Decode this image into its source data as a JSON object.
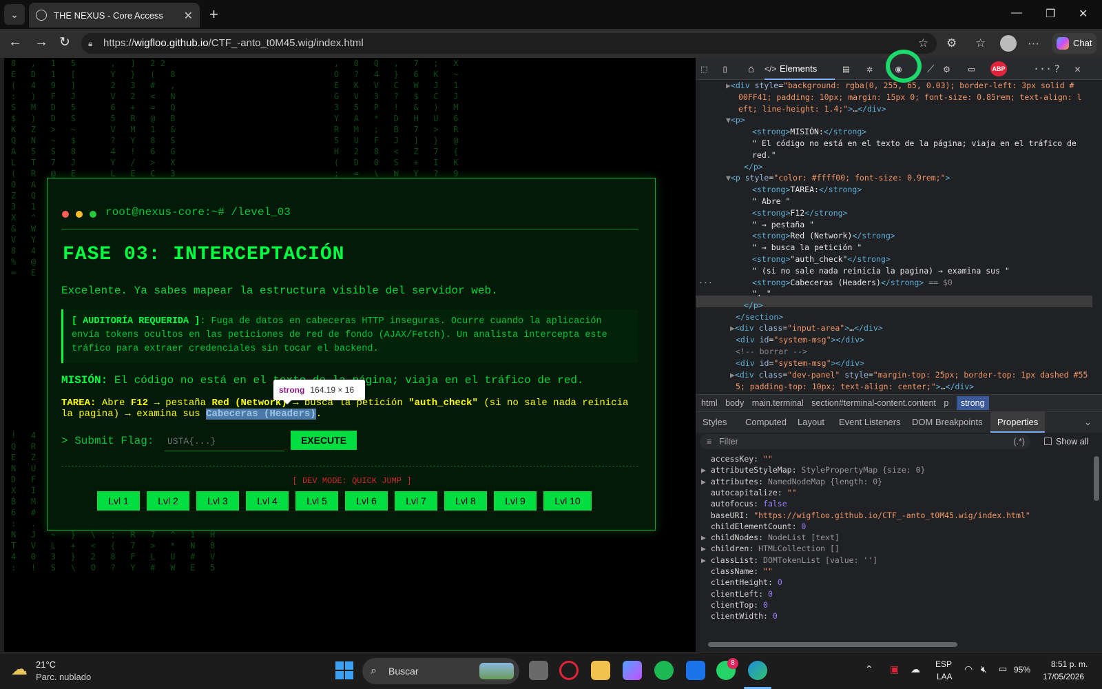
{
  "browser": {
    "tab_title": "THE NEXUS - Core Access",
    "url_prefix": "https://",
    "url_host": "wigfloo.github.io",
    "url_path": "/CTF_-anto_t0M45.wig/index.html",
    "chat_label": "Chat"
  },
  "terminal": {
    "prompt": "root@nexus-core:~# /level_03",
    "title": "FASE 03: INTERCEPTACIÓN",
    "intro": "Excelente. Ya sabes mapear la estructura visible del servidor web.",
    "audit_label": "[ AUDITORÍA REQUERIDA ]",
    "audit_text": ": Fuga de datos en cabeceras HTTP inseguras. Ocurre cuando la aplicación envía tokens ocultos en las peticiones de red de fondo (AJAX/Fetch). Un analista intercepta este tráfico para extraer credenciales sin tocar el backend.",
    "mision_label": "MISIÓN:",
    "mision_text": " El código no está en el texto de la página; viaja en el tráfico de red.",
    "tarea_label": "TAREA:",
    "tarea_1": " Abre ",
    "tarea_f12": "F12",
    "tarea_2": " → pestaña ",
    "tarea_red": "Red (Network)",
    "tarea_3": " → busca la petición ",
    "tarea_auth": "\"auth_check\"",
    "tarea_4": " (si no sale nada reinicia la pagina) → examina sus ",
    "tarea_headers": "Cabeceras (Headers)",
    "tarea_5": ".",
    "submit_label": "> Submit Flag:",
    "flag_placeholder": "USTA{...}",
    "execute_label": "EXECUTE",
    "devmode_label": "[ DEV MODE: QUICK JUMP ]",
    "levels": [
      "Lvl 1",
      "Lvl 2",
      "Lvl 3",
      "Lvl 4",
      "Lvl 5",
      "Lvl 6",
      "Lvl 7",
      "Lvl 8",
      "Lvl 9",
      "Lvl 10"
    ]
  },
  "tooltip": {
    "tag": "strong",
    "size": "164.19 × 16"
  },
  "devtools": {
    "elements_tab": "Elements",
    "abp": "ABP",
    "breadcrumbs": [
      "html",
      "body",
      "main.terminal",
      "section#terminal-content.content",
      "p",
      "strong"
    ],
    "subtabs": [
      "Styles",
      "Computed",
      "Layout",
      "Event Listeners",
      "DOM Breakpoints",
      "Properties"
    ],
    "filter_placeholder": "Filter",
    "regex_btn": "(.*)",
    "show_all": "Show all",
    "properties": [
      {
        "k": "accessKey",
        "v": "\"\"",
        "t": "s"
      },
      {
        "k": "attributeStyleMap",
        "v": "StylePropertyMap {size: 0}",
        "t": "o"
      },
      {
        "k": "attributes",
        "v": "NamedNodeMap {length: 0}",
        "t": "o"
      },
      {
        "k": "autocapitalize",
        "v": "\"\"",
        "t": "s"
      },
      {
        "k": "autofocus",
        "v": "false",
        "t": "n"
      },
      {
        "k": "baseURI",
        "v": "\"https://wigfloo.github.io/CTF_-anto_t0M45.wig/index.html\"",
        "t": "s"
      },
      {
        "k": "childElementCount",
        "v": "0",
        "t": "n"
      },
      {
        "k": "childNodes",
        "v": "NodeList [text]",
        "t": "o"
      },
      {
        "k": "children",
        "v": "HTMLCollection []",
        "t": "o"
      },
      {
        "k": "classList",
        "v": "DOMTokenList [value: '']",
        "t": "o"
      },
      {
        "k": "className",
        "v": "\"\"",
        "t": "s"
      },
      {
        "k": "clientHeight",
        "v": "0",
        "t": "n"
      },
      {
        "k": "clientLeft",
        "v": "0",
        "t": "n"
      },
      {
        "k": "clientTop",
        "v": "0",
        "t": "n"
      },
      {
        "k": "clientWidth",
        "v": "0",
        "t": "n"
      }
    ]
  },
  "taskbar": {
    "weather_temp": "21°C",
    "weather_desc": "Parc. nublado",
    "search_label": "Buscar",
    "whatsapp_badge": "8",
    "lang_1": "ESP",
    "lang_2": "LAA",
    "battery": "95%",
    "time": "8:51 p. m.",
    "date": "17/05/2026"
  }
}
